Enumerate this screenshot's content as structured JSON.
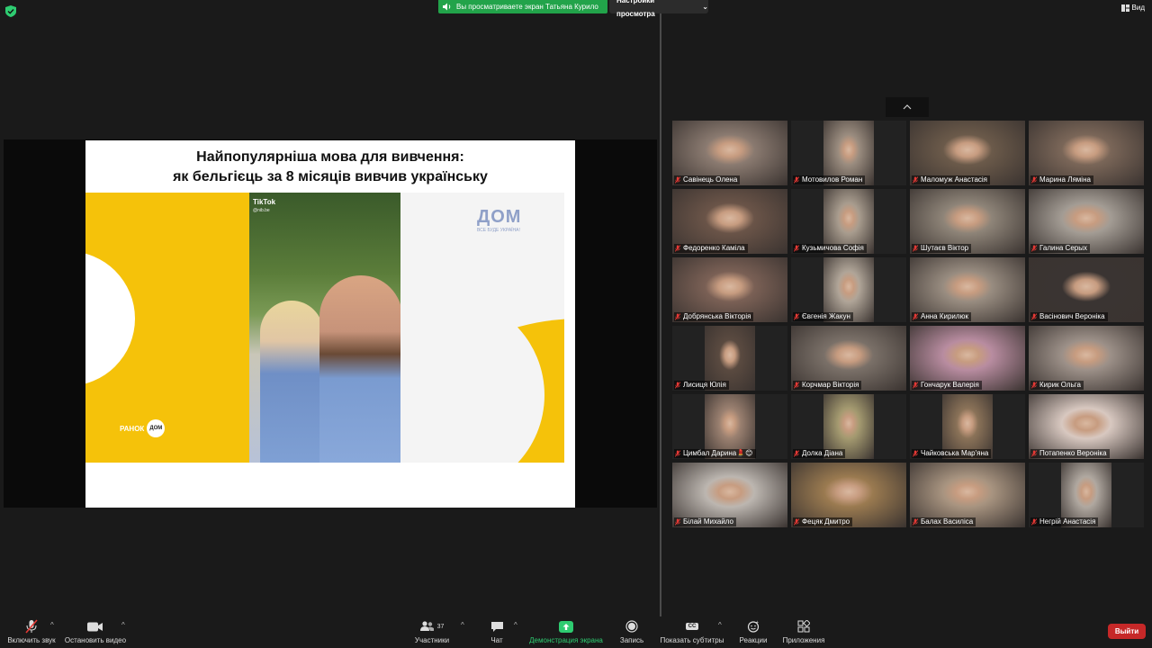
{
  "topbar": {
    "share_banner": "Вы просматриваете экран Татьяна Курило",
    "view_settings": "Настройки просмотра",
    "view_button": "Вид"
  },
  "slide": {
    "title_line1": "Найпопулярніша мова для вивчення:",
    "title_line2": "як бельгієць за 8 місяців вивчив українську",
    "tiktok": "TikTok",
    "tiktok_user": "@nib.be",
    "ranok": "РАНОК",
    "dom_badge": "ДОМ",
    "dom_logo": "ДОМ",
    "dom_tagline": "ВСЕ БУДЕ УКРАЇНА!"
  },
  "participants": [
    {
      "name": "Савінець Олена",
      "color": "#8a7a70"
    },
    {
      "name": "Мотовилов Роман",
      "color": "#9a8c7f"
    },
    {
      "name": "Маломуж Анастасія",
      "color": "#6b5a4a"
    },
    {
      "name": "Марина Ляміна",
      "color": "#7a6658"
    },
    {
      "name": "Федоренко Каміла",
      "color": "#6a5448"
    },
    {
      "name": "Кузьмичова Софія",
      "color": "#a89c8e"
    },
    {
      "name": "Шутаєв Віктор",
      "color": "#8e8478"
    },
    {
      "name": "Галина Серых",
      "color": "#a39c94"
    },
    {
      "name": "Добрянська Вікторія",
      "color": "#7a6055"
    },
    {
      "name": "Євгенія Жакун",
      "color": "#b0a598"
    },
    {
      "name": "Анна Кирилюк",
      "color": "#988c80"
    },
    {
      "name": "Васінович Вероніка",
      "color": "#3a3432"
    },
    {
      "name": "Лисиця Юлія",
      "color": "#5a4a40"
    },
    {
      "name": "Корчмар Вікторія",
      "color": "#7a7068"
    },
    {
      "name": "Гончарук Валерія",
      "color": "#b88ca0"
    },
    {
      "name": "Кирик Ольга",
      "color": "#9c9088"
    },
    {
      "name": "Цимбал Дарина💄😊",
      "color": "#9a8070"
    },
    {
      "name": "Долка Діана",
      "color": "#a49a70"
    },
    {
      "name": "Чайковська Мар'яна",
      "color": "#8a7258"
    },
    {
      "name": "Потапенко Вероніка",
      "color": "#d8c8c0"
    },
    {
      "name": "Білай Михайло",
      "color": "#bcb6b0"
    },
    {
      "name": "Фецяк Дмитро",
      "color": "#9a7a50"
    },
    {
      "name": "Балах Василіса",
      "color": "#a89480"
    },
    {
      "name": "Негрій Анастасія",
      "color": "#b0a8a0"
    }
  ],
  "toolbar": {
    "audio": "Включить звук",
    "video": "Остановить видео",
    "participants": "Участники",
    "participants_count": "37",
    "chat": "Чат",
    "share": "Демонстрация экрана",
    "record": "Запись",
    "captions": "Показать субтитры",
    "captions_badge": "CC",
    "reactions": "Реакции",
    "apps": "Приложения",
    "end": "Выйти",
    "share_color": "#2ecc71",
    "end_color": "#c62828"
  }
}
